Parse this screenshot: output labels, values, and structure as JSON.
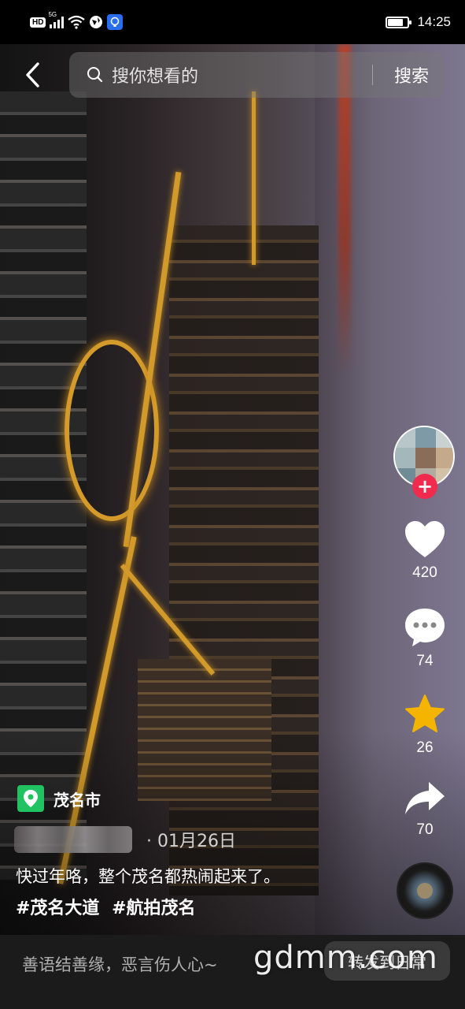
{
  "status_bar": {
    "hd_badge": "HD",
    "network": "5G",
    "time": "14:25",
    "battery_level": 0.7
  },
  "search": {
    "placeholder": "搜你想看的",
    "button_label": "搜索"
  },
  "actions": {
    "likes": "420",
    "comments": "74",
    "favorites": "26",
    "shares": "70"
  },
  "location": {
    "name": "茂名市"
  },
  "post": {
    "date": "· 01月26日",
    "caption": "快过年咯，整个茂名都热闹起来了。",
    "tags": [
      "#茂名大道",
      "#航拍茂名"
    ]
  },
  "comment_bar": {
    "placeholder": "善语结善缘，恶言伤人心~",
    "share_label": "转发到日常"
  },
  "watermark": "gdmm.com",
  "colors": {
    "like_white": "#ffffff",
    "favorite_star": "#f5b400",
    "follow_red": "#f02b4e",
    "location_green": "#20c261"
  }
}
